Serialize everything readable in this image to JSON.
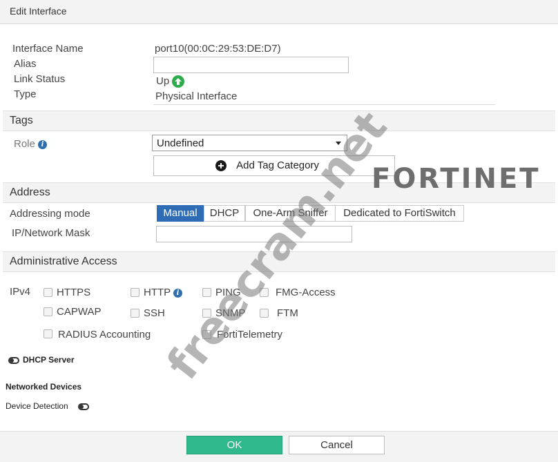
{
  "dialog": {
    "title": "Edit Interface"
  },
  "interface": {
    "name_label": "Interface Name",
    "name_value": "port10(00:0C:29:53:DE:D7)",
    "alias_label": "Alias",
    "alias_value": "",
    "link_status_label": "Link Status",
    "link_status_value": "Up",
    "type_label": "Type",
    "type_value": "Physical Interface"
  },
  "tags": {
    "header": "Tags",
    "role_label": "Role",
    "role_value": "Undefined",
    "add_tag_label": "Add Tag Category"
  },
  "address": {
    "header": "Address",
    "mode_label": "Addressing mode",
    "modes": [
      "Manual",
      "DHCP",
      "One-Arm Sniffer",
      "Dedicated to FortiSwitch"
    ],
    "active_mode": "Manual",
    "ip_label": "IP/Network Mask",
    "ip_value": ""
  },
  "admin_access": {
    "header": "Administrative Access",
    "ipv4_label": "IPv4",
    "options": [
      {
        "label": "HTTPS",
        "checked": false
      },
      {
        "label": "HTTP",
        "checked": false
      },
      {
        "label": "PING",
        "checked": false
      },
      {
        "label": "FMG-Access",
        "checked": false
      },
      {
        "label": "CAPWAP",
        "checked": false
      },
      {
        "label": "SSH",
        "checked": false
      },
      {
        "label": "SNMP",
        "checked": false
      },
      {
        "label": "FTM",
        "checked": false
      },
      {
        "label": "RADIUS Accounting",
        "checked": false
      },
      {
        "label": "FortiTelemetry",
        "checked": false
      }
    ]
  },
  "dhcp_server": {
    "label": "DHCP Server",
    "enabled": false
  },
  "networked_devices": {
    "header": "Networked Devices",
    "detection_label": "Device Detection",
    "detection_enabled": false
  },
  "footer": {
    "ok_label": "OK",
    "cancel_label": "Cancel"
  },
  "overlay": {
    "brand": "FORTINET",
    "watermark": "freecram.net"
  },
  "colors": {
    "accent": "#2e6cb5",
    "ok_green": "#2fb98c",
    "up_green": "#2eac4b"
  }
}
